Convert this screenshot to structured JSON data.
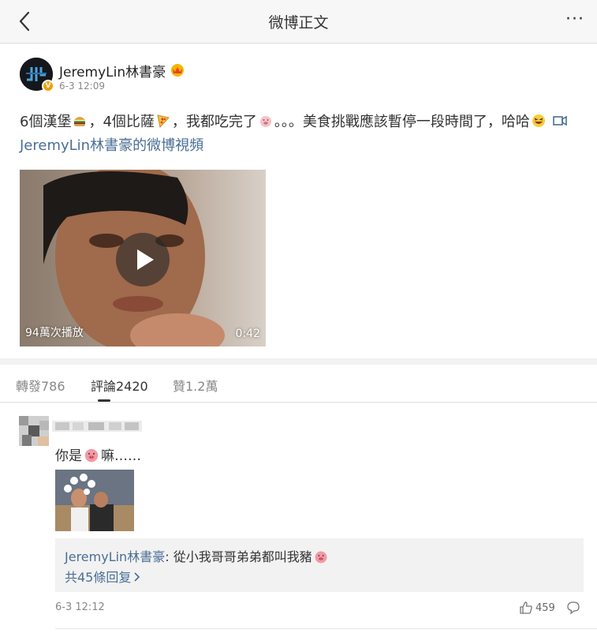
{
  "header": {
    "title": "微博正文",
    "more_label": "···"
  },
  "post": {
    "author": "JeremyLin林書豪",
    "date": "6-3 12:09",
    "text_1": "6個漢堡",
    "emoji_1": "hamburger-emoji",
    "text_2": "，4個比薩",
    "emoji_2": "pizza-emoji",
    "text_3": "，我都吃完了",
    "emoji_3": "pig-emoji",
    "text_4": "。。。美食挑戰應該暫停一段時間了，哈哈",
    "emoji_4": "laughing-emoji",
    "video_link": "JeremyLin林書豪的微博視頻",
    "video": {
      "play_count": "94萬次播放",
      "duration": "0:42"
    }
  },
  "tabs": [
    {
      "label": "轉發786"
    },
    {
      "label": "評論2420"
    },
    {
      "label": "贊1.2萬"
    }
  ],
  "comment": {
    "text": "你是",
    "text_suffix": "嘛……",
    "reply": {
      "author": "JeremyLin林書豪",
      "separator": ": ",
      "text": "從小我哥哥弟弟都叫我豬",
      "more": "共45條回复"
    },
    "date": "6-3 12:12",
    "likes": "459"
  },
  "colors": {
    "link": "#4a6e96",
    "badge": "#f0a000"
  }
}
